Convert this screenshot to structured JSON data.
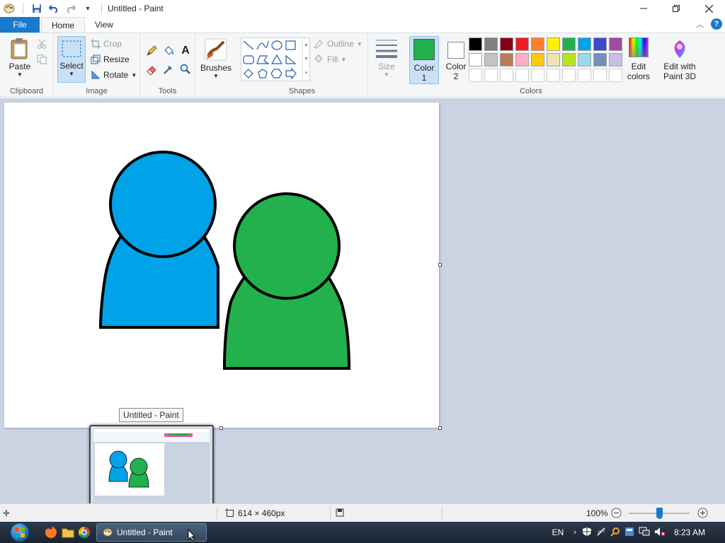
{
  "window": {
    "title": "Untitled - Paint"
  },
  "tabs": {
    "file": "File",
    "home": "Home",
    "view": "View"
  },
  "ribbon": {
    "clipboard": {
      "paste": "Paste",
      "label": "Clipboard"
    },
    "image": {
      "select": "Select",
      "crop": "Crop",
      "resize": "Resize",
      "rotate": "Rotate",
      "label": "Image"
    },
    "tools": {
      "label": "Tools"
    },
    "brushes": {
      "label": "Brushes"
    },
    "shapes": {
      "outline": "Outline",
      "fill": "Fill",
      "label": "Shapes"
    },
    "size": {
      "label": "Size"
    },
    "color1": {
      "line1": "Color",
      "line2": "1",
      "value": "#22b14c"
    },
    "color2": {
      "line1": "Color",
      "line2": "2",
      "value": "#ffffff"
    },
    "colors": {
      "label": "Colors",
      "row1": [
        "#000000",
        "#7f7f7f",
        "#880015",
        "#ed1c24",
        "#ff7f27",
        "#fff200",
        "#22b14c",
        "#00a2e8",
        "#3f48cc",
        "#a349a4"
      ],
      "row2": [
        "#ffffff",
        "#c3c3c3",
        "#b97a57",
        "#ffaec9",
        "#ffc90e",
        "#efe4b0",
        "#b5e61d",
        "#99d9ea",
        "#7092be",
        "#c8bfe7"
      ]
    },
    "edit_colors": {
      "line1": "Edit",
      "line2": "colors"
    },
    "paint3d": {
      "line1": "Edit with",
      "line2": "Paint 3D"
    }
  },
  "canvas": {
    "person_blue": "#00a2e8",
    "person_green": "#22b14c"
  },
  "tooltip": {
    "text": "Untitled - Paint"
  },
  "statusbar": {
    "canvas_size": "614 × 460px",
    "zoom": "100%"
  },
  "taskbar": {
    "task_label": "Untitled - Paint",
    "lang": "EN",
    "time": "8:23 AM"
  }
}
